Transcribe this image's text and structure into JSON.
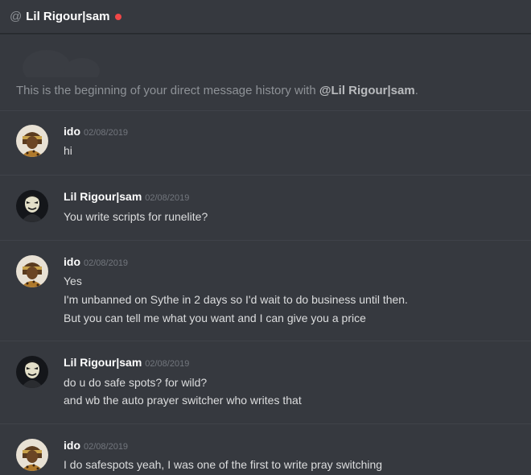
{
  "header": {
    "at_symbol": "@",
    "recipient": "Lil Rigour|sam",
    "status_color": "#f04747"
  },
  "intro": {
    "prefix": "This is the beginning of your direct message history with ",
    "mention": "@Lil Rigour|sam",
    "suffix": "."
  },
  "messages": [
    {
      "author": "ido",
      "timestamp": "02/08/2019",
      "avatar_icon": "pharaoh-avatar",
      "lines": [
        "hi"
      ]
    },
    {
      "author": "Lil Rigour|sam",
      "timestamp": "02/08/2019",
      "avatar_icon": "masked-figure-avatar",
      "lines": [
        "You write scripts for runelite?"
      ]
    },
    {
      "author": "ido",
      "timestamp": "02/08/2019",
      "avatar_icon": "pharaoh-avatar",
      "lines": [
        "Yes",
        "I'm unbanned on Sythe in 2 days so I'd wait to do business until then.",
        "But you can tell me what you want and I can give you a price"
      ]
    },
    {
      "author": "Lil Rigour|sam",
      "timestamp": "02/08/2019",
      "avatar_icon": "masked-figure-avatar",
      "lines": [
        "do u do safe spots? for wild?",
        "and wb the auto prayer switcher who writes that"
      ]
    },
    {
      "author": "ido",
      "timestamp": "02/08/2019",
      "avatar_icon": "pharaoh-avatar",
      "lines": [
        "I do safespots yeah, I was one of the first to write pray switching"
      ]
    }
  ]
}
